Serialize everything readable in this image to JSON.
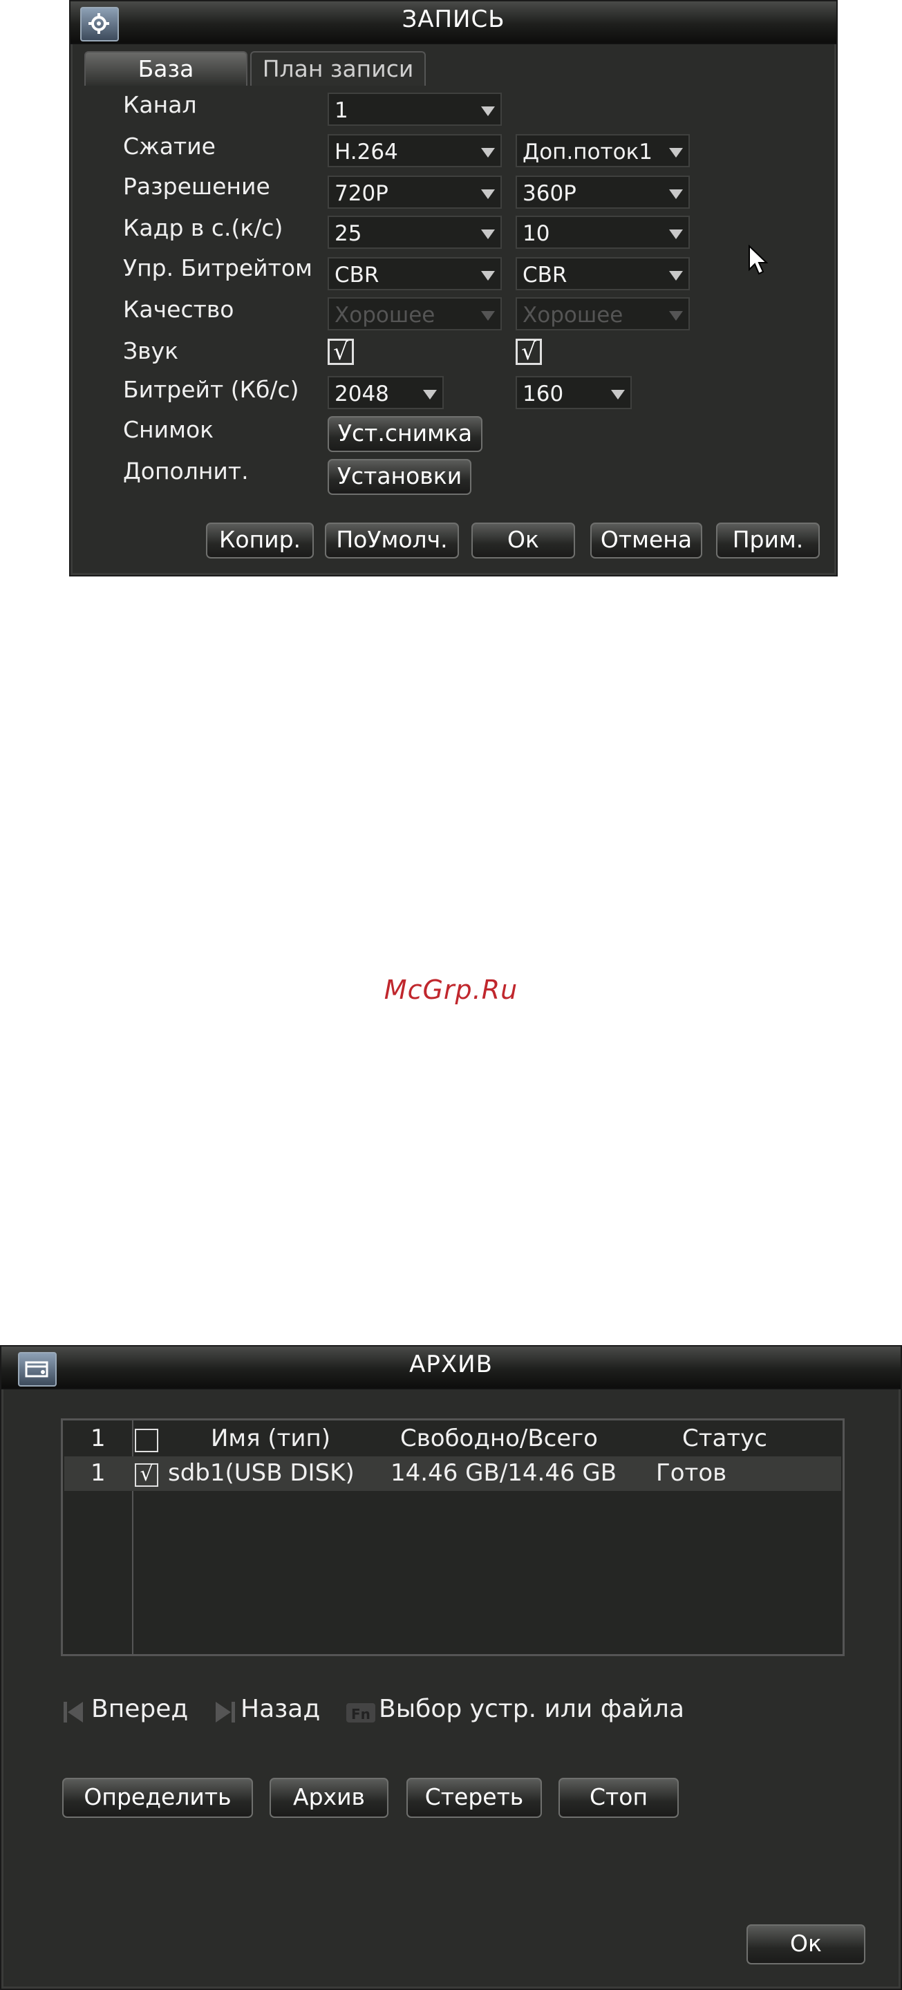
{
  "record_dialog": {
    "title": "ЗАПИСЬ",
    "tabs": [
      {
        "label": "База"
      },
      {
        "label": "План записи"
      }
    ],
    "rows": {
      "channel": {
        "label": "Канал",
        "main": "1"
      },
      "compression": {
        "label": "Сжатие",
        "main": "H.264",
        "extra": "Доп.поток1"
      },
      "resolution": {
        "label": "Разрешение",
        "main": "720P",
        "extra": "360P"
      },
      "fps": {
        "label": "Кадр в с.(к/с)",
        "main": "25",
        "extra": "10"
      },
      "bitrate_control": {
        "label": "Упр. Битрейтом",
        "main": "CBR",
        "extra": "CBR"
      },
      "quality": {
        "label": "Качество",
        "main": "Хорошее",
        "extra": "Хорошее"
      },
      "audio": {
        "label": "Звук",
        "main_checked": "√",
        "extra_checked": "√"
      },
      "bitrate": {
        "label": "Битрейт (Кб/с)",
        "main": "2048",
        "extra": "160"
      },
      "snapshot": {
        "label": "Снимок",
        "button": "Уст.снимка"
      },
      "advanced": {
        "label": "Дополнит.",
        "button": "Установки"
      }
    },
    "buttons": {
      "copy": "Копир.",
      "default": "ПоУмолч.",
      "ok": "Ок",
      "cancel": "Отмена",
      "apply": "Прим."
    }
  },
  "watermark": "McGrp.Ru",
  "archive_dialog": {
    "title": "АРХИВ",
    "table": {
      "headers": {
        "num": "1",
        "name": "Имя (тип)",
        "free_total": "Свободно/Всего",
        "status": "Статус"
      },
      "rows": [
        {
          "num": "1",
          "checked": "√",
          "name": "sdb1(USB DISK)",
          "free_total": "14.46 GB/14.46 GB",
          "status": "Готов"
        }
      ]
    },
    "hints": {
      "forward": "Вперед",
      "back": "Назад",
      "select": "Выбор устр. или файла"
    },
    "buttons": {
      "detect": "Определить",
      "archive": "Архив",
      "erase": "Стереть",
      "stop": "Стоп",
      "ok": "Ок"
    }
  }
}
